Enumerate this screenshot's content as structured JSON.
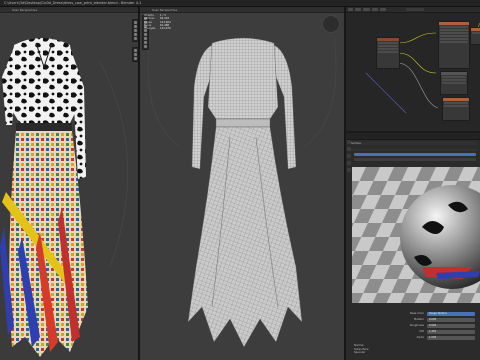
{
  "window": {
    "title": "C:\\Users\\3d\\Desktop\\Clo3d_Dress\\dress_cow_print_blender.blend - Blender 4.1"
  },
  "viewport_left": {
    "header": "User Perspective"
  },
  "viewport_mid": {
    "header": "User Perspective",
    "stats": [
      {
        "key": "Objects",
        "value": "1 / 3"
      },
      {
        "key": "Vertices",
        "value": "62,418"
      },
      {
        "key": "Edges",
        "value": "123,904"
      },
      {
        "key": "Faces",
        "value": "61,488"
      },
      {
        "key": "Triangles",
        "value": "122,976"
      }
    ]
  },
  "node_editor": {
    "icons": [
      "editor-type-icon",
      "view-menu",
      "select-menu",
      "add-menu",
      "node-menu"
    ]
  },
  "properties": {
    "section": "Surface",
    "form_rows": [
      {
        "label": "Base Color",
        "value": "Image Texture"
      },
      {
        "label": "Metallic",
        "value": "0.000"
      },
      {
        "label": "Roughness",
        "value": "0.500"
      },
      {
        "label": "IOR",
        "value": "1.450"
      },
      {
        "label": "Alpha",
        "value": "1.000"
      }
    ],
    "footer_items": [
      "Normal",
      "Subsurface",
      "Specular"
    ]
  },
  "colors": {
    "accent_blue": "#4772b3",
    "viewport_bg": "#3b3b3b",
    "panel_bg": "#2b2b2b",
    "node_header_orange": "#b0603a",
    "node_header_grey": "#555555"
  }
}
